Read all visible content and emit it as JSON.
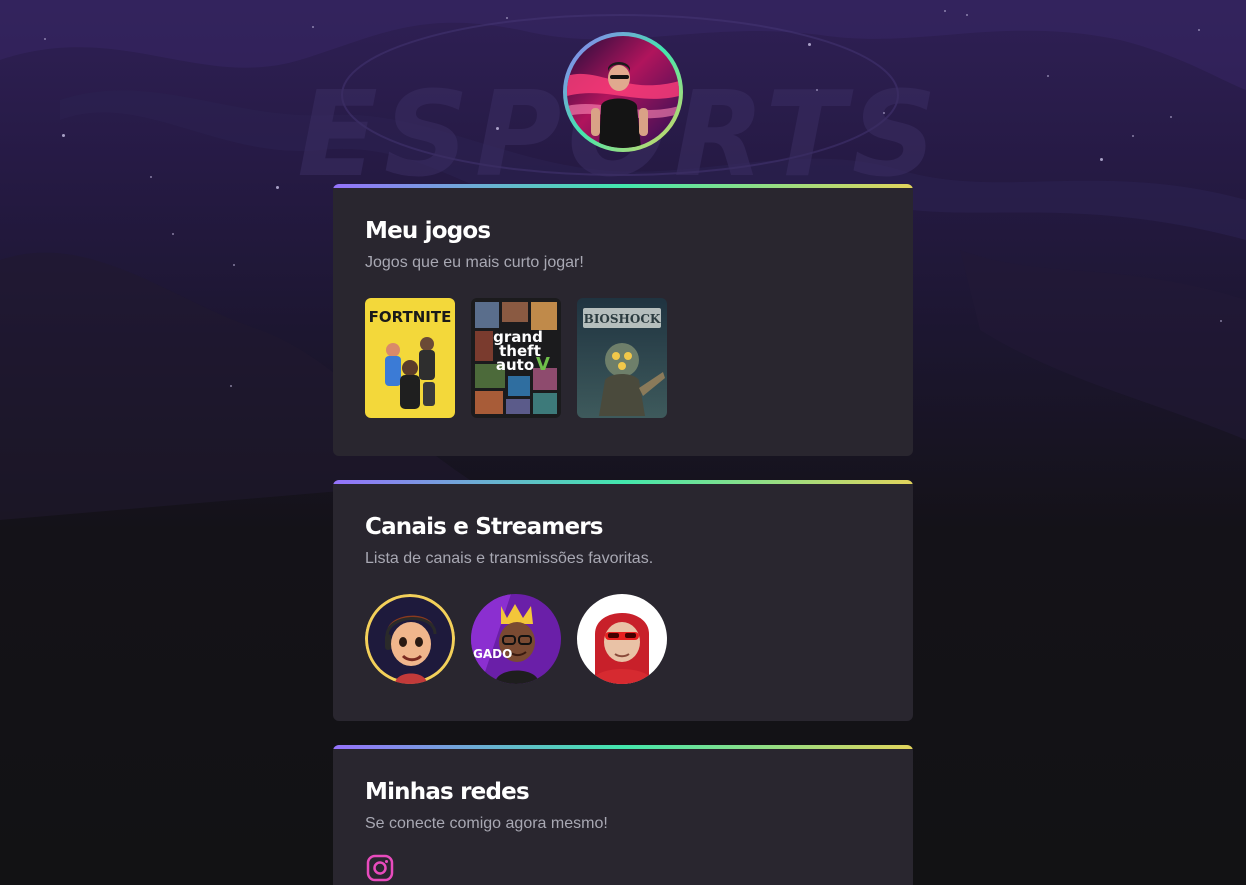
{
  "profile": {
    "avatar_icon": "profile-photo"
  },
  "background": {
    "watermark_text": "ESPORTS"
  },
  "games_section": {
    "title": "Meu jogos",
    "subtitle": "Jogos que eu mais curto jogar!",
    "games": [
      {
        "name": "FORTNITE",
        "cover_color": "#f3d83a"
      },
      {
        "name": "grand theft auto V",
        "cover_color": "#1b1b1d"
      },
      {
        "name": "BIOSHOCK",
        "cover_color": "#2a4350"
      }
    ]
  },
  "streamers_section": {
    "title": "Canais e Streamers",
    "subtitle": "Lista de canais e transmissões favoritas.",
    "streamers": [
      {
        "icon": "streamer-avatar-cartoon",
        "ring_color": "#f3d05a"
      },
      {
        "icon": "streamer-avatar-crown",
        "badge_text": "GADO"
      },
      {
        "icon": "streamer-avatar-red-hood"
      }
    ]
  },
  "social_section": {
    "title": "Minhas redes",
    "subtitle": "Se conecte comigo agora mesmo!",
    "icons": [
      "instagram-icon"
    ]
  },
  "colors": {
    "gradient_start": "#9572fc",
    "gradient_mid": "#43e7ad",
    "gradient_end": "#e2d45c",
    "card_bg": "#29262f",
    "instagram_pink": "#e84bbd"
  }
}
